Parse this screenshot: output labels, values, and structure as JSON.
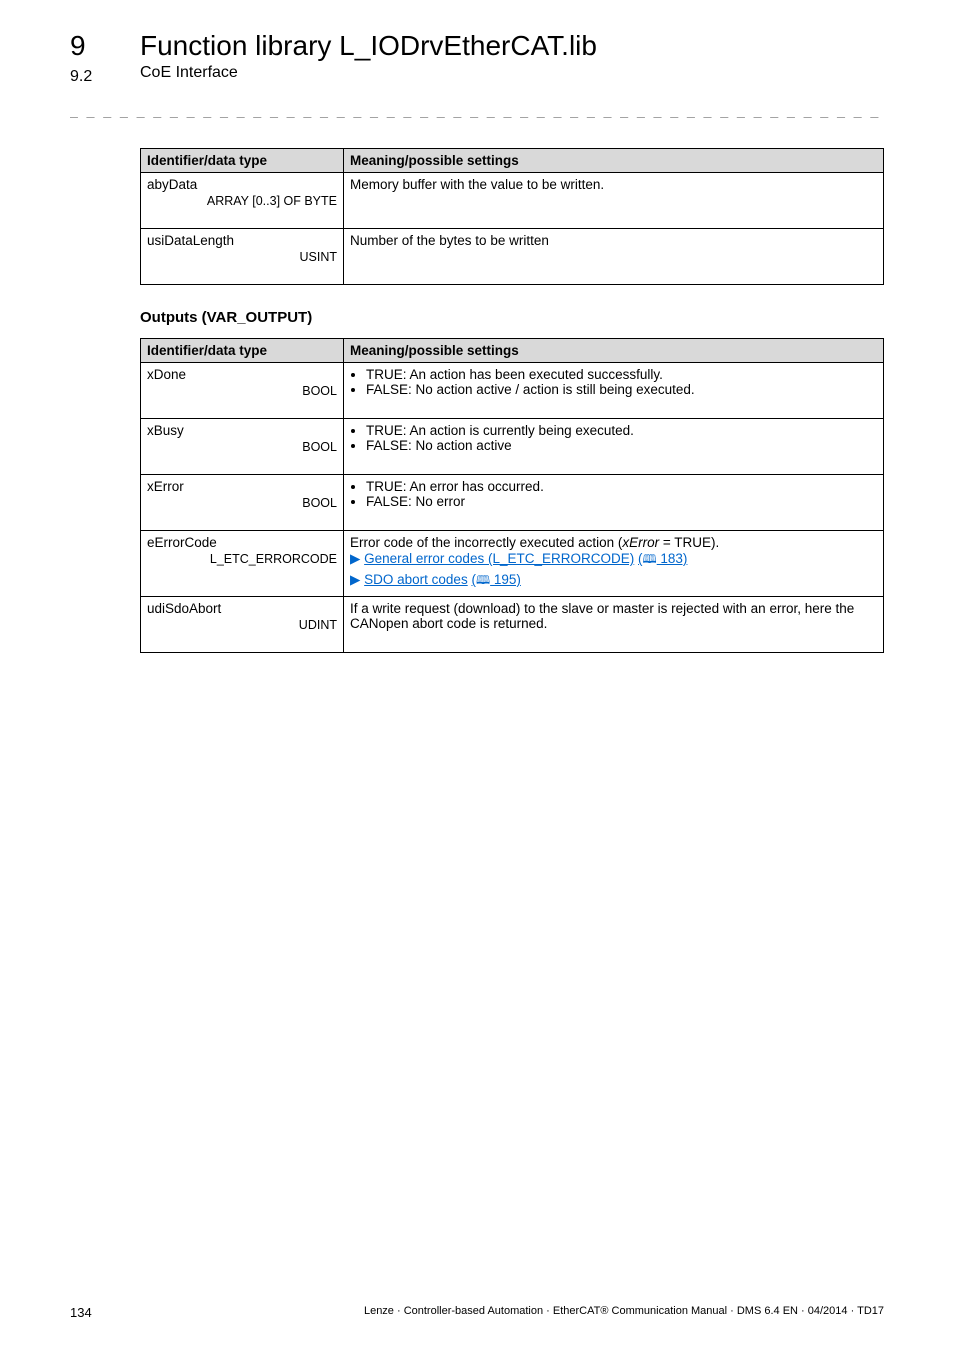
{
  "chapter_num": "9",
  "chapter_title": "Function library L_IODrvEtherCAT.lib",
  "section_num": "9.2",
  "section_title": "CoE Interface",
  "dash_line": "_ _ _ _ _ _ _ _ _ _ _ _ _ _ _ _ _ _ _ _ _ _ _ _ _ _ _ _ _ _ _ _ _ _ _ _ _ _ _ _ _ _ _ _ _ _ _ _ _ _ _ _ _ _ _ _ _ _ _ _ _ _ _ _",
  "table1": {
    "headers": [
      "Identifier/data type",
      "Meaning/possible settings"
    ],
    "rows": [
      {
        "id": "abyData",
        "type": "ARRAY [0..3] OF BYTE",
        "meaning": "Memory buffer with the value to be written."
      },
      {
        "id": "usiDataLength",
        "type": "USINT",
        "meaning": "Number of the bytes to be written"
      }
    ]
  },
  "outputs_heading": "Outputs (VAR_OUTPUT)",
  "table2": {
    "headers": [
      "Identifier/data type",
      "Meaning/possible settings"
    ],
    "rows": [
      {
        "id": "xDone",
        "type": "BOOL",
        "bullets": [
          "TRUE: An action has been executed successfully.",
          "FALSE: No action active / action is still being executed."
        ]
      },
      {
        "id": "xBusy",
        "type": "BOOL",
        "bullets": [
          "TRUE: An action is currently being executed.",
          "FALSE: No action active"
        ]
      },
      {
        "id": "xError",
        "type": "BOOL",
        "bullets": [
          "TRUE: An error has occurred.",
          "FALSE: No error"
        ]
      },
      {
        "id": "eErrorCode",
        "type": "L_ETC_ERRORCODE",
        "line_pre": "Error code of the incorrectly executed action (",
        "line_italic": "xError",
        "line_post": " = TRUE).",
        "link1_text": "General error codes (L_ETC_ERRORCODE)",
        "link1_page": " 183)",
        "link2_text": "SDO abort codes",
        "link2_page": " 195)"
      },
      {
        "id": "udiSdoAbort",
        "type": "UDINT",
        "text": "If a write request (download) to the slave or master is rejected with an error, here the CANopen abort code is returned."
      }
    ]
  },
  "footer": {
    "page": "134",
    "text": "Lenze · Controller-based Automation · EtherCAT® Communication Manual · DMS 6.4 EN · 04/2014 · TD17"
  }
}
